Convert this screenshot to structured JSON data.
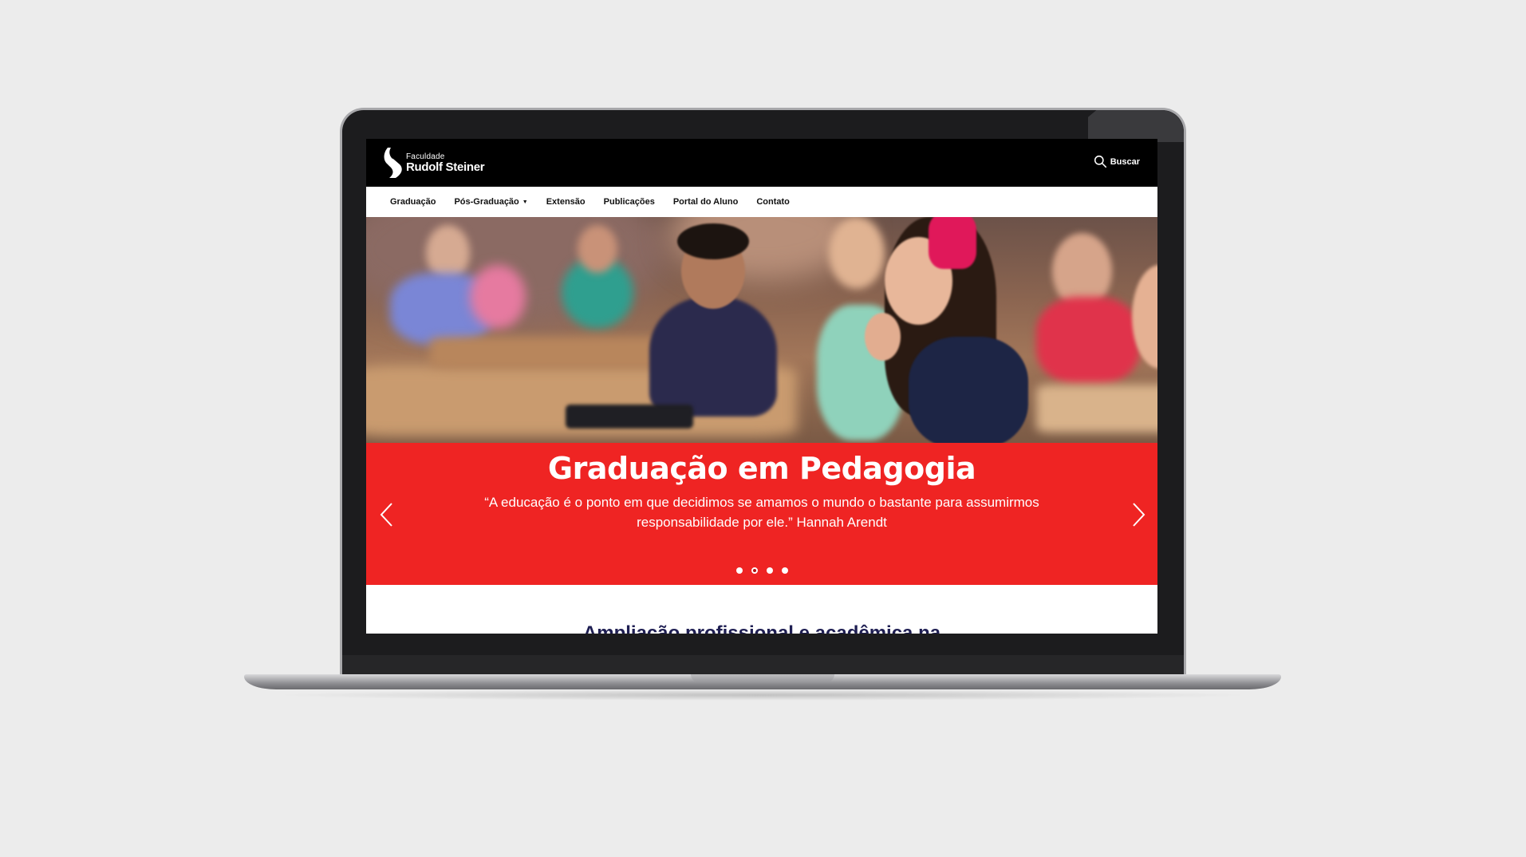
{
  "header": {
    "logo_small": "Faculdade",
    "logo_big": "Rudolf Steiner",
    "search_label": "Buscar"
  },
  "nav": {
    "items": [
      {
        "label": "Graduação"
      },
      {
        "label": "Pós-Graduação"
      },
      {
        "label": "Extensão"
      },
      {
        "label": "Publicações"
      },
      {
        "label": "Portal do Aluno"
      },
      {
        "label": "Contato"
      }
    ]
  },
  "hero": {
    "title": "Graduação em Pedagogia",
    "quote": "“A educação é o ponto em que decidimos se amamos o mundo o bastante para assumirmos responsabilidade por ele.” Hannah Arendt",
    "slide_count": 4,
    "active_slide": 2
  },
  "section": {
    "title": "Ampliação profissional e acadêmica na"
  },
  "colors": {
    "brand_red": "#ef2423",
    "topbar": "#000000",
    "section_title": "#1e1e52"
  }
}
